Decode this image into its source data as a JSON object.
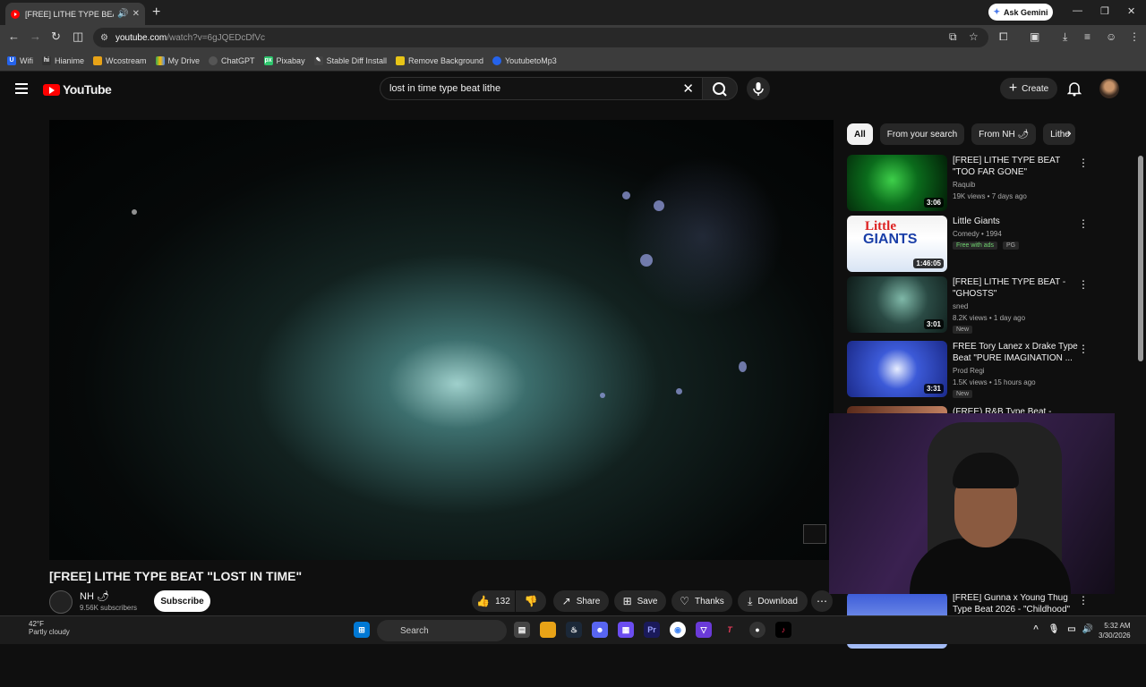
{
  "browser": {
    "tab_title": "[FREE] LITHE TYPE BEAT \"LOST IN TIME\"",
    "new_tab": "+",
    "gemini_label": "Ask Gemini",
    "url_host": "youtube.com",
    "url_path": "/watch?v=6gJQEDcDfVc",
    "bookmarks": [
      "Wifi",
      "Hianime",
      "Wcostream",
      "My Drive",
      "ChatGPT",
      "Pixabay",
      "Stable Diff Install",
      "Remove Background",
      "YoutubetoMp3"
    ]
  },
  "youtube": {
    "logo_text": "YouTube",
    "search_query": "lost in time type beat lithe",
    "create_label": "Create"
  },
  "video": {
    "title": "[FREE] LITHE TYPE BEAT \"LOST IN TIME\"",
    "channel": "NH 🌶",
    "subscribers": "9.56K subscribers",
    "subscribe_label": "Subscribe",
    "likes": "132",
    "share_label": "Share",
    "save_label": "Save",
    "thanks_label": "Thanks",
    "download_label": "Download"
  },
  "chips": [
    "All",
    "From your search",
    "From NH 🌶",
    "Lithe"
  ],
  "recommendations": [
    {
      "title": "[FREE] LITHE TYPE BEAT \"TOO FAR GONE\"",
      "channel": "Raquib",
      "meta": "19K views • 7 days ago",
      "duration": "3:06",
      "badge": ""
    },
    {
      "title": "Little Giants",
      "channel": "Comedy • 1994",
      "meta": "Free with ads",
      "rating": "PG",
      "duration": "1:46:05",
      "badge": ""
    },
    {
      "title": "[FREE] LITHE TYPE BEAT - \"GHOSTS\"",
      "channel": "sned",
      "meta": "8.2K views • 1 day ago",
      "duration": "3:01",
      "badge": "New"
    },
    {
      "title": "FREE Tory Lanez x Drake Type Beat \"PURE IMAGINATION ...",
      "channel": "Prod Regi",
      "meta": "1.5K views • 15 hours ago",
      "duration": "3:31",
      "badge": "New"
    },
    {
      "title": "(FREE) R&B Type Beat -",
      "channel": "",
      "meta": "",
      "duration": "",
      "badge": ""
    },
    {
      "title": "[FREE] Gunna x Young Thug Type Beat 2026 - \"Childhood\"",
      "channel": "",
      "meta": "",
      "duration": "",
      "badge": ""
    }
  ],
  "taskbar": {
    "weather_temp": "42°F",
    "weather_cond": "Partly cloudy",
    "search_label": "Search",
    "time": "5:32 AM",
    "date": "3/30/2026"
  },
  "colors": {
    "accent": "#ff0000",
    "background": "#0f0f0f",
    "chip_active": "#f1f1f1"
  }
}
